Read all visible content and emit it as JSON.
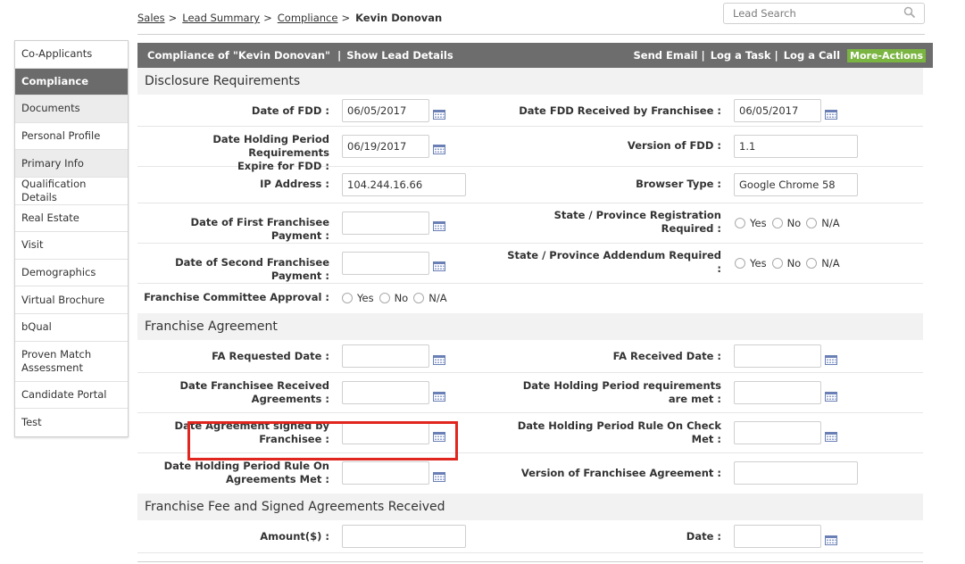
{
  "breadcrumb": {
    "items": [
      "Sales",
      "Lead Summary",
      "Compliance"
    ],
    "current": "Kevin Donovan",
    "separator": ">"
  },
  "search": {
    "placeholder": "Lead Search",
    "icon": "search-icon"
  },
  "sidebar": {
    "items": [
      {
        "label": "Co-Applicants"
      },
      {
        "label": "Compliance",
        "active": true
      },
      {
        "label": "Documents"
      },
      {
        "label": "Personal Profile"
      },
      {
        "label": "Primary Info"
      },
      {
        "label": "Qualification Details"
      },
      {
        "label": "Real Estate"
      },
      {
        "label": "Visit"
      },
      {
        "label": "Demographics"
      },
      {
        "label": "Virtual Brochure"
      },
      {
        "label": "bQual"
      },
      {
        "label": "Proven Match Assessment"
      },
      {
        "label": "Candidate Portal"
      },
      {
        "label": "Test"
      }
    ]
  },
  "header_bar": {
    "title": "Compliance of \"Kevin Donovan\"",
    "pipe": "|",
    "show_lead_details": "Show Lead Details",
    "send_email": "Send Email",
    "log_task": "Log a Task",
    "log_call": "Log a Call",
    "more_actions": "More-Actions",
    "bar_color": "#6d6d6d",
    "more_color": "#7ab441"
  },
  "radio_options": [
    "Yes",
    "No",
    "N/A"
  ],
  "sections": {
    "disclosure": {
      "title": "Disclosure Requirements",
      "date_of_fdd": {
        "label": "Date of FDD :",
        "value": "06/05/2017"
      },
      "date_fdd_received": {
        "label": "Date FDD Received by Franchisee :",
        "value": "06/05/2017"
      },
      "holding_period_fdd": {
        "label_1": "Date Holding Period Requirements",
        "label_2": "Expire for FDD :",
        "value": "06/19/2017"
      },
      "version_fdd": {
        "label": "Version of FDD :",
        "value": "1.1"
      },
      "ip_address": {
        "label": "IP Address :",
        "value": "104.244.16.66"
      },
      "browser_type": {
        "label": "Browser Type :",
        "value": "Google Chrome 58"
      },
      "first_payment": {
        "label": "Date of First Franchisee Payment :",
        "value": ""
      },
      "state_registration": {
        "label_1": "State / Province Registration",
        "label_2": "Required :"
      },
      "second_payment": {
        "label": "Date of Second Franchisee Payment :",
        "value": ""
      },
      "state_addendum": {
        "label_1": "State / Province Addendum Required",
        "label_2": ":"
      },
      "committee_approval": {
        "label": "Franchise Committee Approval :"
      }
    },
    "agreement": {
      "title": "Franchise Agreement",
      "fa_requested": {
        "label": "FA Requested Date :",
        "value": ""
      },
      "fa_received": {
        "label": "FA Received Date :",
        "value": ""
      },
      "franchisee_received": {
        "label_1": "Date Franchisee Received",
        "label_2": "Agreements :",
        "value": ""
      },
      "holding_met": {
        "label_1": "Date Holding Period requirements",
        "label_2": "are met :",
        "value": ""
      },
      "agreement_signed": {
        "label_1": "Date Agreement signed by",
        "label_2": "Franchisee :",
        "value": ""
      },
      "holding_check": {
        "label_1": "Date Holding Period Rule On Check",
        "label_2": "Met :",
        "value": ""
      },
      "holding_agreements": {
        "label_1": "Date Holding Period Rule On",
        "label_2": "Agreements Met :",
        "value": ""
      },
      "version_agreement": {
        "label": "Version of Franchisee Agreement :",
        "value": ""
      }
    },
    "fee": {
      "title": "Franchise Fee and Signed Agreements Received",
      "amount": {
        "label": "Amount($) :",
        "value": ""
      },
      "date": {
        "label": "Date :",
        "value": ""
      }
    }
  },
  "highlight_color": "#e0261e"
}
